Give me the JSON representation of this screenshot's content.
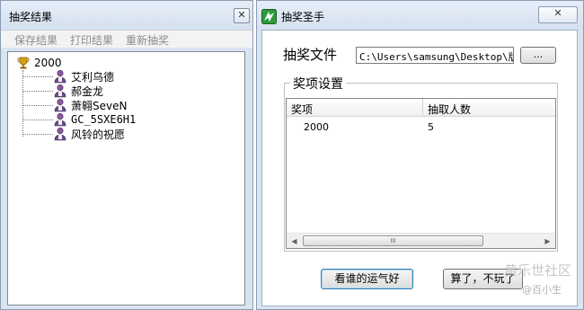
{
  "result_window": {
    "title": "抽奖结果",
    "close_glyph": "✕",
    "menu": [
      "保存结果",
      "打印结果",
      "重新抽奖"
    ],
    "tree": {
      "root": {
        "label": "2000",
        "icon": "trophy-icon"
      },
      "winners": [
        "艾利乌德",
        "郝金龙",
        "萧翱SeveN",
        "GC_5SXE6H1",
        "风铃的祝愿"
      ],
      "winner_icon": "person-icon"
    }
  },
  "main_window": {
    "title": "抽奖圣手",
    "icon": "app-icon",
    "close_glyph": "✕",
    "file_label": "抽奖文件",
    "file_path": "C:\\Users\\samsung\\Desktop\\版块",
    "browse_label": "...",
    "prize_group": {
      "label": "奖项设置",
      "columns": [
        "奖项",
        "抽取人数"
      ],
      "rows": [
        {
          "prize": "2000",
          "count": "5"
        }
      ],
      "scrollbar_grip": "III"
    },
    "draw_button": "看谁的运气好",
    "quit_button": "算了，不玩了"
  },
  "watermark": {
    "text": "黄乐世社区",
    "sub": "@百小生"
  }
}
